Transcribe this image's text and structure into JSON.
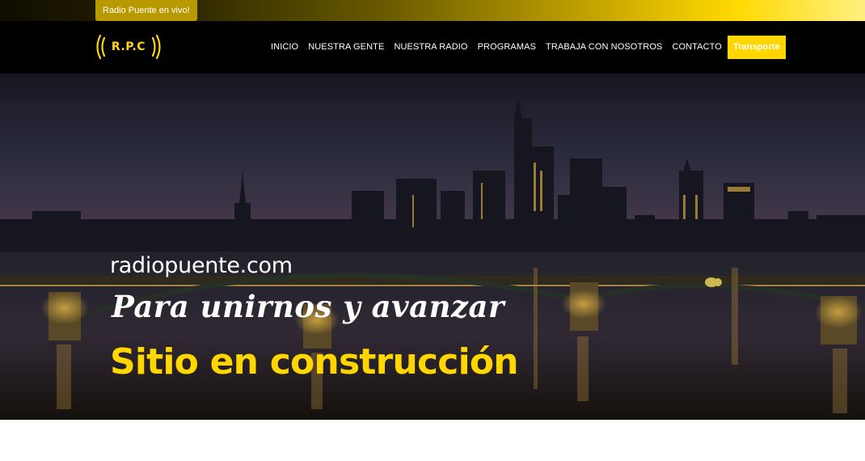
{
  "topbar": {
    "live_label": "Radio Puente en vivo!"
  },
  "header": {
    "logo_text": "((R.P.C))",
    "nav": [
      {
        "label": "INICIO"
      },
      {
        "label": "NUESTRA GENTE"
      },
      {
        "label": "NUESTRA RADIO"
      },
      {
        "label": "PROGRAMAS"
      },
      {
        "label": "TRABAJA CON NOSOTROS"
      },
      {
        "label": "CONTACTO"
      },
      {
        "label": "Transporte"
      }
    ]
  },
  "hero": {
    "domain": "radiopuente.com",
    "tagline": "Para unirnos y avanzar",
    "status": "Sitio en construcción"
  },
  "colors": {
    "accent": "#ffd600",
    "navbar": "#000000",
    "text_light": "#ffffff"
  },
  "icons": {
    "logo": "radio-waves-logo-icon"
  }
}
